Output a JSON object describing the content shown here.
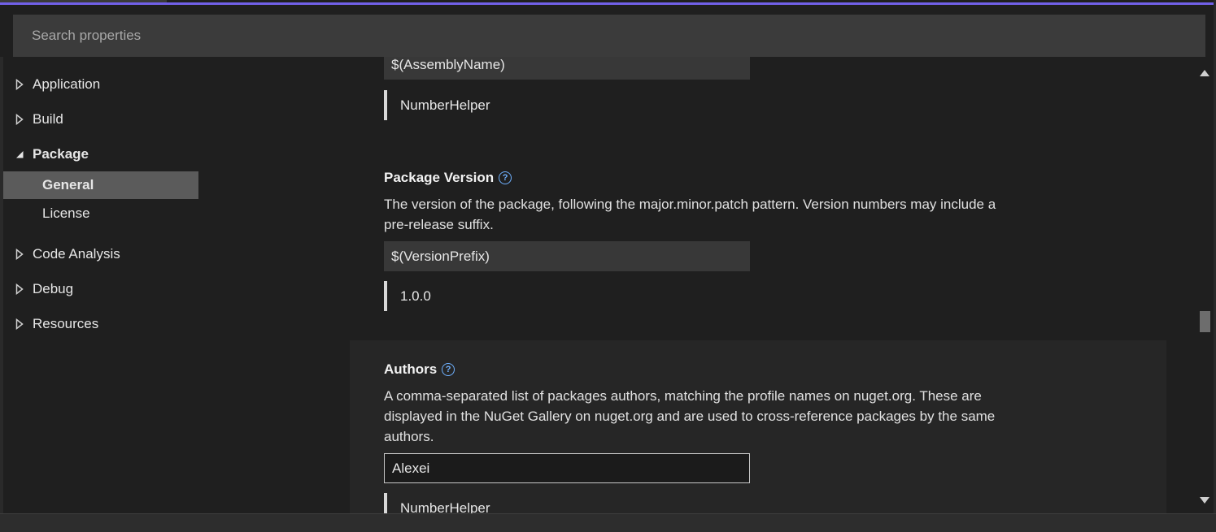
{
  "search": {
    "placeholder": "Search properties"
  },
  "nav": {
    "items": [
      {
        "label": "Application"
      },
      {
        "label": "Build"
      },
      {
        "label": "Package"
      },
      {
        "label": "General"
      },
      {
        "label": "License"
      },
      {
        "label": "Code Analysis"
      },
      {
        "label": "Debug"
      },
      {
        "label": "Resources"
      }
    ]
  },
  "content": {
    "prev_field": {
      "input_value": "$(AssemblyName)",
      "evaluated": "NumberHelper"
    },
    "package_version": {
      "title": "Package Version",
      "description": "The version of the package, following the major.minor.patch pattern. Version numbers may include a pre-release suffix.",
      "input_value": "$(VersionPrefix)",
      "evaluated": "1.0.0"
    },
    "authors": {
      "title": "Authors",
      "description": "A comma-separated list of packages authors, matching the profile names on nuget.org. These are displayed in the NuGet Gallery on nuget.org and are used to cross-reference packages by the same authors.",
      "input_value": "Alexei",
      "evaluated": "NumberHelper"
    }
  },
  "colors": {
    "accent": "#7160e8",
    "help_icon": "#6fb1ff",
    "selected_bg": "#5b5b5b"
  },
  "icons": {
    "help": "?"
  }
}
